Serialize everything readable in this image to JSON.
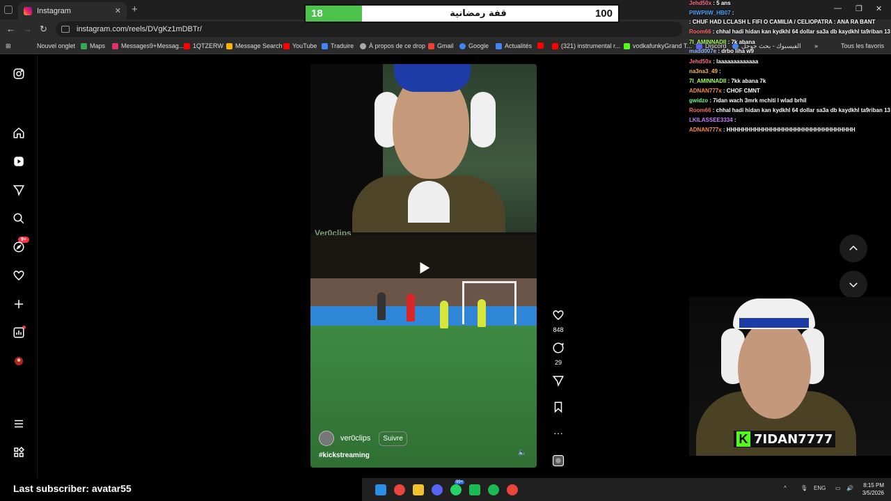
{
  "browser": {
    "tab_title": "Instagram",
    "url": "instagram.com/reels/DVgKz1mDBTr/",
    "bookmarks": [
      "Nouvel onglet",
      "Maps",
      "Messages9+Messag...",
      "1QTZERW",
      "Message Search",
      "YouTube",
      "Traduire",
      "À propos de ce drop",
      "Gmail",
      "Google",
      "Actualités",
      "(321) instrumental r...",
      "vodkafunkyGrand T...",
      "Discord",
      "الفيسبوك - بحث جوجل"
    ],
    "all_favorites": "Tous les favoris"
  },
  "score_overlay": {
    "current": "18",
    "title": "قفة رمضانية",
    "goal": "100",
    "progress": 0.18
  },
  "instagram": {
    "nav_icons": [
      "instagram-logo-icon",
      "home-icon",
      "reels-icon",
      "messages-icon",
      "search-icon",
      "explore-icon",
      "notifications-icon",
      "create-icon",
      "dashboard-icon",
      "profile-avatar",
      "more-menu-icon",
      "also-from-meta-icon"
    ],
    "messages_badge": "9+",
    "reel": {
      "watermark": "Ver0clips",
      "username": "ver0clips",
      "follow_label": "Suivre",
      "hashtag": "#kickstreaming",
      "likes": "848",
      "comments": "29"
    }
  },
  "chat": [
    {
      "user": "Jehd50x",
      "msg": "5 ans",
      "color": "#ff6b8a"
    },
    {
      "user": "PIIWPIIW_HB07",
      "msg": "",
      "color": "#4aa3ff"
    },
    {
      "user": "",
      "msg": "CHUF HAD LCLASH L FIFI O CAMILIA / CELIOPATRA : ANA RA BANT",
      "color": "#ffffff"
    },
    {
      "user": "Room66",
      "msg": "chhal hadi hidan kan kydkhl 64 dollar sa3a db kaydkhl ta9riban 13 dollar",
      "color": "#ff6b6b"
    },
    {
      "user": "7I_AMINNADII",
      "msg": "7k abana",
      "color": "#a6ff4d"
    },
    {
      "user": "madd007e",
      "msg": "drbo liha w9",
      "color": "#a0c0ff"
    },
    {
      "user": "Jehd50x",
      "msg": "laaaaaaaaaaaaa",
      "color": "#ff6b8a"
    },
    {
      "user": "na3na3_49",
      "msg": "",
      "color": "#ffb84d"
    },
    {
      "user": "7I_AMINNADII",
      "msg": "7kk abana 7k",
      "color": "#a6ff4d"
    },
    {
      "user": "ADNAN777x",
      "msg": "CHOF CMNT",
      "color": "#ff8c3a"
    },
    {
      "user": "gwidzo",
      "msg": "7idan wach 3mrk mchiti l wlad brhil",
      "color": "#6bff9a"
    },
    {
      "user": "Room66",
      "msg": "chhal hadi hidan kan kydkhl 64 dollar sa3a db kaydkhl ta9riban 13 dollar",
      "color": "#ff6b6b"
    },
    {
      "user": "LKILASSEE3334",
      "msg": "",
      "color": "#c77dff"
    },
    {
      "user": "ADNAN777x",
      "msg": "HHHHHHHHHHHHHHHHHHHHHHHHHHHHHHHH",
      "color": "#ff8c3a"
    }
  ],
  "streamer": {
    "name": "7IDAN7777",
    "brand_letter": "K",
    "brand_color": "#53fc18"
  },
  "subscriber_banner": "Last subscriber: avatar55",
  "taskbar": {
    "language": "ENG",
    "time": "8:15 PM",
    "date": "3/5/2026",
    "chat_badge": "99+"
  }
}
